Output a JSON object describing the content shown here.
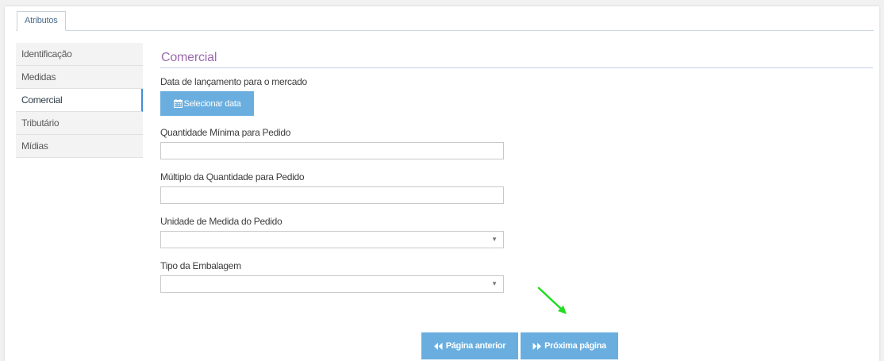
{
  "tabs": [
    {
      "label": "Atributos",
      "active": true
    }
  ],
  "sidebar": {
    "items": [
      {
        "label": "Identificação",
        "active": false
      },
      {
        "label": "Medidas",
        "active": false
      },
      {
        "label": "Comercial",
        "active": true
      },
      {
        "label": "Tributário",
        "active": false
      },
      {
        "label": "Mídias",
        "active": false
      }
    ]
  },
  "form": {
    "title": "Comercial",
    "launch_date_label": "Data de lançamento para o mercado",
    "select_date_button": "Selecionar data",
    "select_date_icon": "calendar-icon",
    "min_qty_label": "Quantidade Mínima para Pedido",
    "min_qty_value": "",
    "multiple_qty_label": "Múltiplo da Quantidade para Pedido",
    "multiple_qty_value": "",
    "unit_label": "Unidade de Medida do Pedido",
    "unit_selected": "",
    "package_label": "Tipo da Embalagem",
    "package_selected": ""
  },
  "pager": {
    "prev_label": "Página anterior",
    "prev_icon": "double-chevron-left-icon",
    "next_label": "Próxima página",
    "next_icon": "double-chevron-right-icon"
  },
  "colors": {
    "accent": "#69aedf",
    "section_title": "#9b6ab0",
    "annotation_arrow": "#22dd22"
  }
}
